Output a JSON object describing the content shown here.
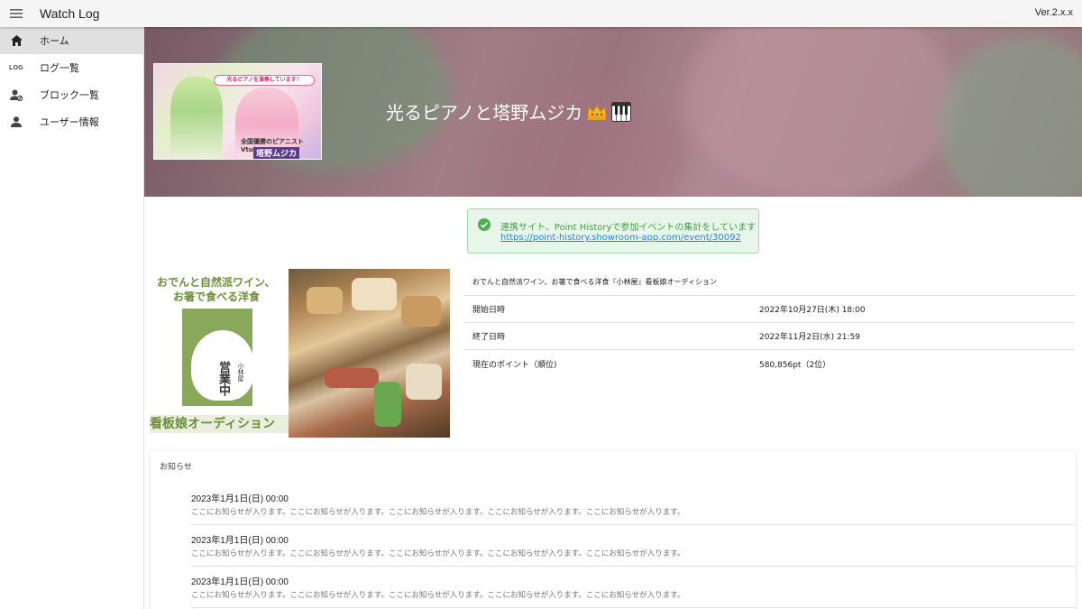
{
  "appbar": {
    "title": "Watch Log",
    "version": "Ver.2.x.x"
  },
  "sidebar": {
    "items": [
      {
        "label": "ホーム",
        "icon": "home-icon",
        "active": true
      },
      {
        "label": "ログ一覧",
        "icon": "log-icon",
        "icon_text": "LOG",
        "active": false
      },
      {
        "label": "ブロック一覧",
        "icon": "person-block-icon",
        "active": false
      },
      {
        "label": "ユーザー情報",
        "icon": "person-icon",
        "active": false
      }
    ]
  },
  "banner": {
    "title": "光るピアノと塔野ムジカ",
    "title_icons": [
      "crown-emoji",
      "piano-emoji"
    ],
    "thumbnail": {
      "tag": "光るピアノを演奏しています！",
      "subtitle": "全国優勝のピアニストVtuber",
      "name": "塔野ムジカ"
    }
  },
  "alert": {
    "icon": "check-circle-icon",
    "message": "連携サイト、Point Historyで参加イベントの集計をしています",
    "link": "https://point-history.showroom-app.com/event/30092"
  },
  "event_image": {
    "heading_line1": "おでんと自然派ワイン、",
    "heading_line2": "お箸で食べる洋食",
    "board_text": "営業中",
    "board_small": "小林屋",
    "footer": "看板娘オーディション"
  },
  "event": {
    "title": "おでんと自然派ワイン、お箸で食べる洋食『小林屋』看板娘オーディション",
    "rows": [
      {
        "label": "開始日時",
        "value": "2022年10月27日(木) 18:00"
      },
      {
        "label": "終了日時",
        "value": "2022年11月2日(水) 21:59"
      },
      {
        "label": "現在のポイント（順位)",
        "value": "580,856pt（2位）"
      }
    ]
  },
  "notice": {
    "title": "お知らせ",
    "items": [
      {
        "date": "2023年1月1日(日) 00:00",
        "body": "ここにお知らせが入ります。ここにお知らせが入ります。ここにお知らせが入ります。ここにお知らせが入ります。ここにお知らせが入ります。"
      },
      {
        "date": "2023年1月1日(日) 00:00",
        "body": "ここにお知らせが入ります。ここにお知らせが入ります。ここにお知らせが入ります。ここにお知らせが入ります。ここにお知らせが入ります。"
      },
      {
        "date": "2023年1月1日(日) 00:00",
        "body": "ここにお知らせが入ります。ここにお知らせが入ります。ここにお知らせが入ります。ここにお知らせが入ります。ここにお知らせが入ります。"
      }
    ]
  },
  "colors": {
    "appbar_bg": "#f5f5f5",
    "active_nav": "#e0e0e0",
    "alert_bg": "#e8f5e9",
    "alert_text": "#43a047",
    "link": "#1e88e5"
  }
}
